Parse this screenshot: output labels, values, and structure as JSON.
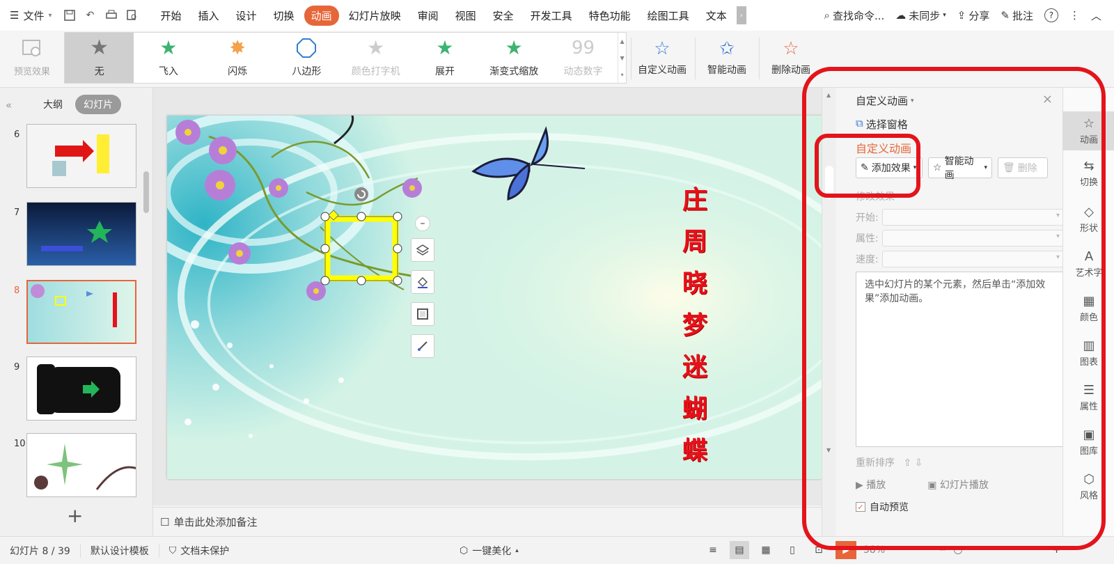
{
  "menubar": {
    "file": "文件",
    "tabs": [
      "开始",
      "插入",
      "设计",
      "切换",
      "动画",
      "幻灯片放映",
      "审阅",
      "视图",
      "安全",
      "开发工具",
      "特色功能",
      "绘图工具",
      "文本"
    ],
    "active_tab": "动画",
    "search": "查找命令...",
    "sync": "未同步",
    "share": "分享",
    "comment": "批注"
  },
  "ribbon": {
    "preview": "预览效果",
    "gallery": [
      "无",
      "飞入",
      "闪烁",
      "八边形",
      "颜色打字机",
      "展开",
      "渐变式缩放",
      "动态数字"
    ],
    "custom": "自定义动画",
    "smart": "智能动画",
    "delete": "删除动画"
  },
  "leftpanel": {
    "tab_outline": "大纲",
    "tab_slides": "幻灯片",
    "slide_numbers": [
      "6",
      "7",
      "8",
      "9",
      "10"
    ],
    "current": "8"
  },
  "slide": {
    "vertical_title": [
      "庄",
      "周",
      "晓",
      "梦",
      "迷",
      "蝴",
      "蝶"
    ]
  },
  "notes": "单击此处添加备注",
  "rightpanel": {
    "title": "自定义动画",
    "select_pane": "选择窗格",
    "section": "自定义动画",
    "add_effect": "添加效果",
    "smart_anim": "智能动画",
    "delete": "删除",
    "modify": "修改效果",
    "start": "开始:",
    "property": "属性:",
    "speed": "速度:",
    "hint": "选中幻灯片的某个元素，然后单击“添加效果”添加动画。",
    "reorder": "重新排序",
    "play": "播放",
    "slideshow": "幻灯片播放",
    "auto_preview": "自动预览"
  },
  "sidebar": [
    "动画",
    "切换",
    "形状",
    "艺术字",
    "颜色",
    "图表",
    "属性",
    "图库",
    "风格"
  ],
  "statusbar": {
    "slide_info": "幻灯片 8 / 39",
    "template": "默认设计模板",
    "protect": "文档未保护",
    "beautify": "一键美化",
    "zoom": "38%"
  },
  "colors": {
    "accent": "#e6663a",
    "annotation": "#e3141b",
    "title_red": "#e8101a"
  }
}
